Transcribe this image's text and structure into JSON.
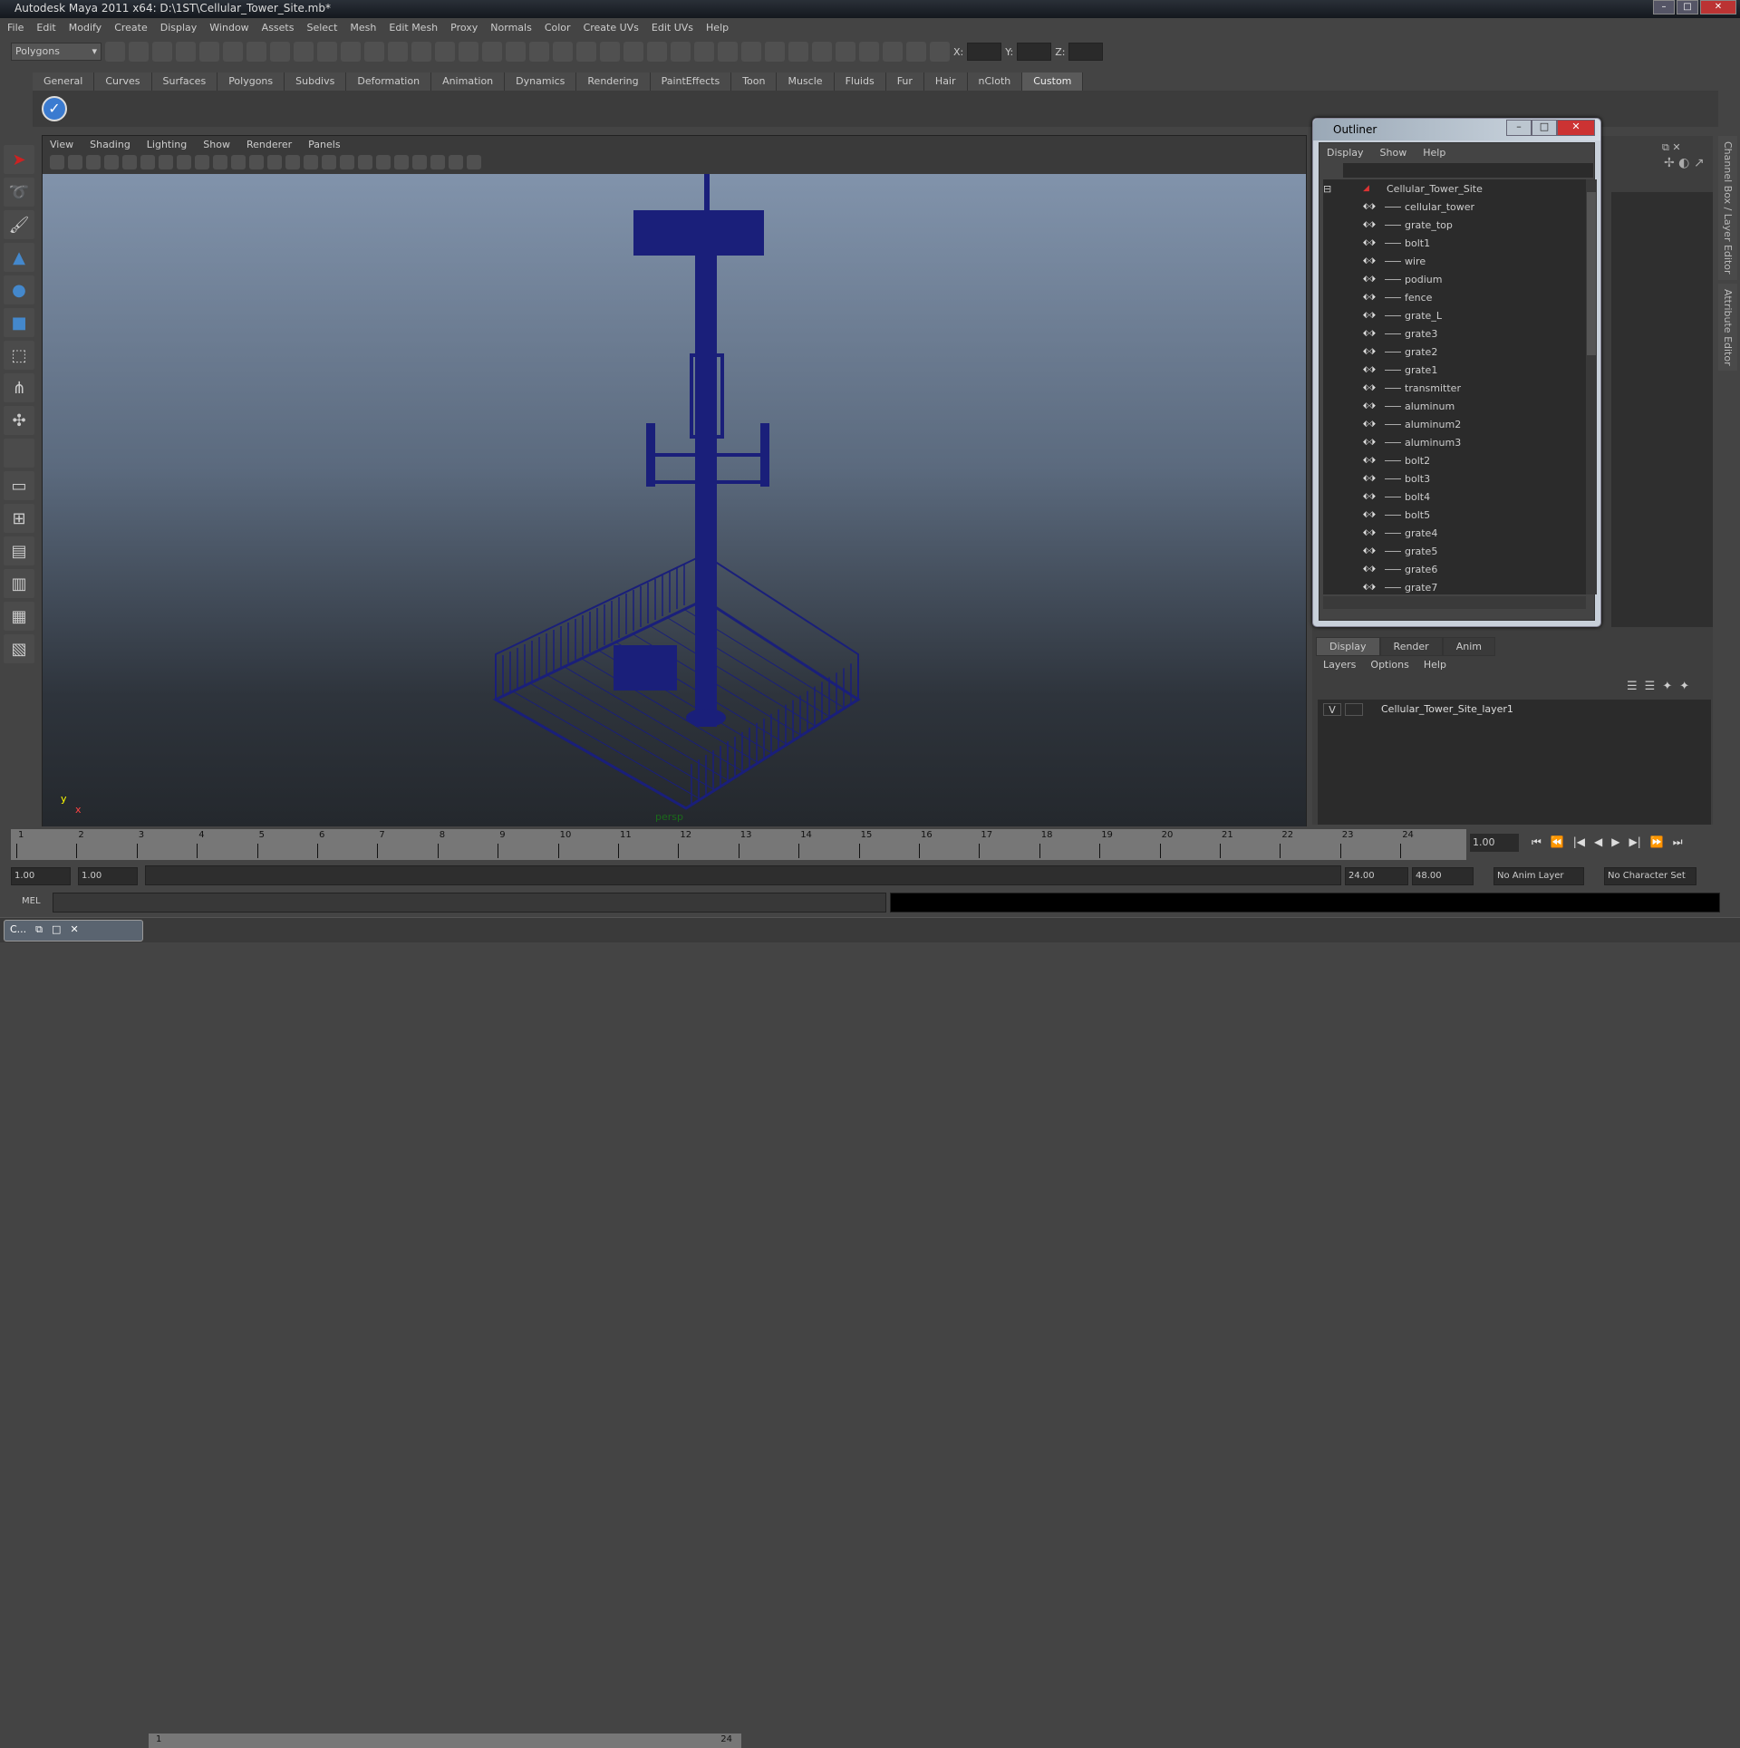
{
  "window": {
    "title": "Autodesk Maya 2011 x64: D:\\1ST\\Cellular_Tower_Site.mb*",
    "min": "–",
    "max": "□",
    "close": "✕"
  },
  "menu": [
    "File",
    "Edit",
    "Modify",
    "Create",
    "Display",
    "Window",
    "Assets",
    "Select",
    "Mesh",
    "Edit Mesh",
    "Proxy",
    "Normals",
    "Color",
    "Create UVs",
    "Edit UVs",
    "Help"
  ],
  "toolbar": {
    "mode": "Polygons",
    "x_label": "X:",
    "y_label": "Y:",
    "z_label": "Z:"
  },
  "shelf_tabs": [
    "General",
    "Curves",
    "Surfaces",
    "Polygons",
    "Subdivs",
    "Deformation",
    "Animation",
    "Dynamics",
    "Rendering",
    "PaintEffects",
    "Toon",
    "Muscle",
    "Fluids",
    "Fur",
    "Hair",
    "nCloth",
    "Custom"
  ],
  "shelf_active": "Custom",
  "viewport": {
    "menu": [
      "View",
      "Shading",
      "Lighting",
      "Show",
      "Renderer",
      "Panels"
    ],
    "camera": "persp",
    "axis_y": "y",
    "axis_x": "x",
    "wire_color": "#1a1f7a"
  },
  "outliner": {
    "title": "Outliner",
    "menu": [
      "Display",
      "Show",
      "Help"
    ],
    "root": "Cellular_Tower_Site",
    "items": [
      "cellular_tower",
      "grate_top",
      "bolt1",
      "wire",
      "podium",
      "fence",
      "grate_L",
      "grate3",
      "grate2",
      "grate1",
      "transmitter",
      "aluminum",
      "aluminum2",
      "aluminum3",
      "bolt2",
      "bolt3",
      "bolt4",
      "bolt5",
      "grate4",
      "grate5",
      "grate6",
      "grate7"
    ]
  },
  "side_tabs": [
    "Channel Box / Layer Editor",
    "Attribute Editor"
  ],
  "layers": {
    "tabs": [
      "Display",
      "Render",
      "Anim"
    ],
    "menu": [
      "Layers",
      "Options",
      "Help"
    ],
    "visible": "V",
    "layer_name": "Cellular_Tower_Site_layer1"
  },
  "timeline": {
    "frames": [
      "1",
      "2",
      "3",
      "4",
      "5",
      "6",
      "7",
      "8",
      "9",
      "10",
      "11",
      "12",
      "13",
      "14",
      "15",
      "16",
      "17",
      "18",
      "19",
      "20",
      "21",
      "22",
      "23",
      "24"
    ],
    "current_frame": "1.00",
    "playback_buttons": [
      "⏮",
      "⏪",
      "|◀",
      "◀",
      "▶",
      "▶|",
      "⏩",
      "⏭"
    ]
  },
  "range": {
    "start": "1.00",
    "playback_start": "1.00",
    "slider_start": "1",
    "slider_end": "24",
    "playback_end": "24.00",
    "end": "48.00",
    "anim_layer": "No Anim Layer",
    "character_set": "No Character Set"
  },
  "mel": {
    "label": "MEL"
  },
  "taskbar": {
    "item": "C..."
  }
}
